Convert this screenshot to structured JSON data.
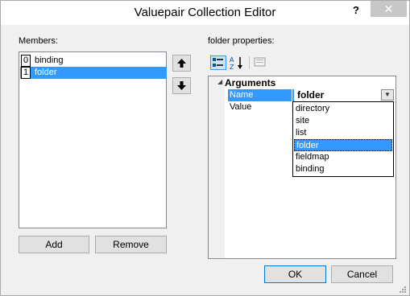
{
  "window": {
    "title": "Valuepair Collection Editor",
    "help_glyph": "?",
    "close_glyph": "✕"
  },
  "members": {
    "label": "Members:",
    "items": [
      {
        "index": "0",
        "label": "binding",
        "selected": false
      },
      {
        "index": "1",
        "label": "folder",
        "selected": true
      }
    ],
    "move_up_icon": "arrow-up-icon",
    "move_down_icon": "arrow-down-icon",
    "add_label": "Add",
    "remove_label": "Remove"
  },
  "properties": {
    "label": "folder properties:",
    "toolbar": {
      "categorized_icon": "categorized-icon",
      "alphabetical_icon": "alphabetical-icon",
      "property_pages_icon": "property-pages-icon"
    },
    "category": "Arguments",
    "rows": [
      {
        "name": "Name",
        "value": "folder",
        "selected": true
      },
      {
        "name": "Value",
        "value": "",
        "selected": false
      }
    ],
    "dropdown_options": [
      "directory",
      "site",
      "list",
      "folder",
      "fieldmap",
      "binding"
    ],
    "dropdown_selected": "folder"
  },
  "footer": {
    "ok_label": "OK",
    "cancel_label": "Cancel"
  }
}
